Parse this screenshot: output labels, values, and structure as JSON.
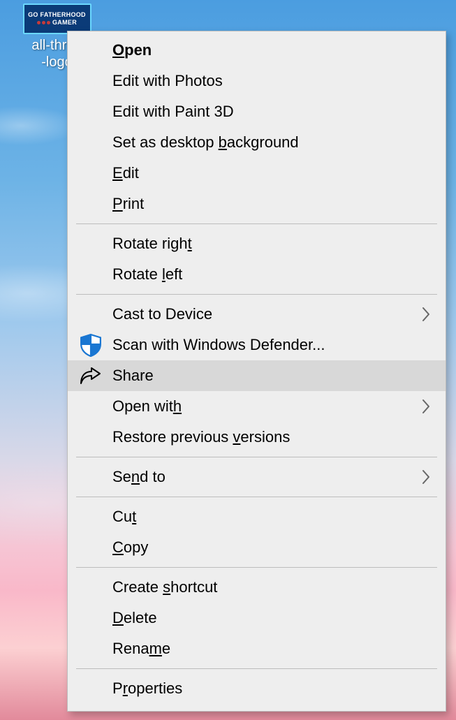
{
  "desktop_icon": {
    "filename_line1": "all-three",
    "filename_line2": "-logo",
    "thumb_line1": "GO FATHERHOOD",
    "thumb_line2": "GAMER"
  },
  "menu": {
    "groups": [
      [
        {
          "id": "open",
          "default": true,
          "pre": "",
          "u": "O",
          "post": "pen"
        },
        {
          "id": "edit-photos",
          "pre": "Edit with Photos",
          "u": "",
          "post": ""
        },
        {
          "id": "edit-paint3d",
          "pre": "Edit with Paint 3D",
          "u": "",
          "post": ""
        },
        {
          "id": "set-bg",
          "pre": "Set as desktop ",
          "u": "b",
          "post": "ackground"
        },
        {
          "id": "edit",
          "pre": "",
          "u": "E",
          "post": "dit"
        },
        {
          "id": "print",
          "pre": "",
          "u": "P",
          "post": "rint"
        }
      ],
      [
        {
          "id": "rotate-right",
          "pre": "Rotate righ",
          "u": "t",
          "post": ""
        },
        {
          "id": "rotate-left",
          "pre": "Rotate ",
          "u": "l",
          "post": "eft"
        }
      ],
      [
        {
          "id": "cast",
          "submenu": true,
          "pre": "Cast to Device",
          "u": "",
          "post": ""
        },
        {
          "id": "defender",
          "icon": "shield",
          "pre": "Scan with Windows Defender...",
          "u": "",
          "post": ""
        },
        {
          "id": "share",
          "icon": "share",
          "highlight": true,
          "pre": "Share",
          "u": "",
          "post": ""
        },
        {
          "id": "open-with",
          "submenu": true,
          "pre": "Open wit",
          "u": "h",
          "post": ""
        },
        {
          "id": "restore",
          "pre": "Restore previous ",
          "u": "v",
          "post": "ersions"
        }
      ],
      [
        {
          "id": "send-to",
          "submenu": true,
          "pre": "Se",
          "u": "n",
          "post": "d to"
        }
      ],
      [
        {
          "id": "cut",
          "pre": "Cu",
          "u": "t",
          "post": ""
        },
        {
          "id": "copy",
          "pre": "",
          "u": "C",
          "post": "opy"
        }
      ],
      [
        {
          "id": "create-shortcut",
          "pre": "Create ",
          "u": "s",
          "post": "hortcut"
        },
        {
          "id": "delete",
          "pre": "",
          "u": "D",
          "post": "elete"
        },
        {
          "id": "rename",
          "pre": "Rena",
          "u": "m",
          "post": "e"
        }
      ],
      [
        {
          "id": "properties",
          "pre": "P",
          "u": "r",
          "post": "operties"
        }
      ]
    ]
  }
}
